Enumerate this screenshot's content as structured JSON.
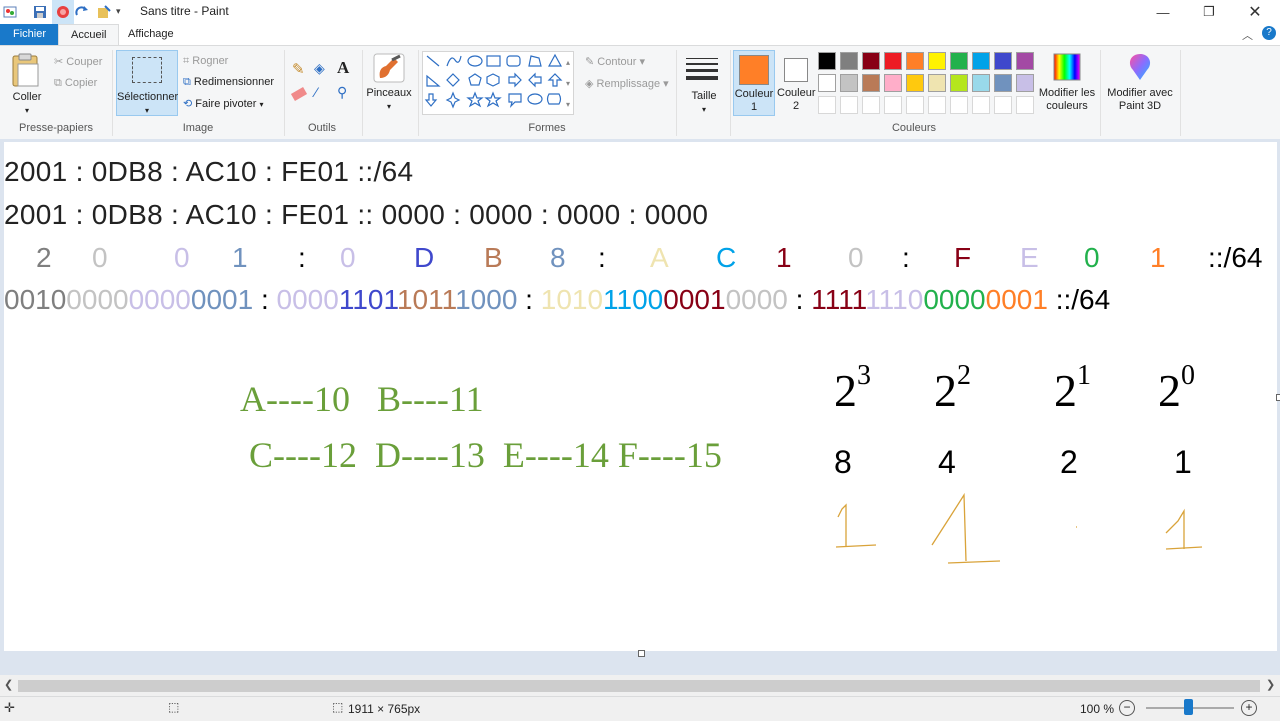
{
  "window": {
    "title": "Sans titre - Paint"
  },
  "tabs": {
    "file": "Fichier",
    "home": "Accueil",
    "view": "Affichage"
  },
  "clipboard": {
    "paste": "Coller",
    "cut": "Couper",
    "copy": "Copier",
    "group": "Presse-papiers"
  },
  "image": {
    "select": "Sélectionner",
    "crop": "Rogner",
    "resize": "Redimensionner",
    "rotate": "Faire pivoter",
    "group": "Image"
  },
  "tools": {
    "group": "Outils"
  },
  "brushes": {
    "label": "Pinceaux"
  },
  "shapes": {
    "outline": "Contour",
    "fill": "Remplissage",
    "group": "Formes"
  },
  "size": {
    "label": "Taille"
  },
  "colors": {
    "color1": "Couleur 1",
    "color1_a": "Couleur",
    "color1_b": "1",
    "color2_a": "Couleur",
    "color2_b": "2",
    "edit_a": "Modifier les",
    "edit_b": "couleurs",
    "paint3d_a": "Modifier avec",
    "paint3d_b": "Paint 3D",
    "group": "Couleurs",
    "color1_value": "#ff7f27",
    "color2_value": "#ffffff",
    "palette_row1": [
      "#000000",
      "#7f7f7f",
      "#880015",
      "#ed1c24",
      "#ff7f27",
      "#fff200",
      "#22b14c",
      "#00a2e8",
      "#3f48cc",
      "#a349a4"
    ],
    "palette_row2": [
      "#ffffff",
      "#c3c3c3",
      "#b97a57",
      "#ffaec9",
      "#ffc90e",
      "#efe4b0",
      "#b5e61d",
      "#99d9ea",
      "#7092be",
      "#c8bfe7"
    ]
  },
  "canvas": {
    "line1": "2001 : 0DB8 : AC10 : FE01 ::/64",
    "line2": "2001 : 0DB8 : AC10 : FE01 :: 0000 : 0000 : 0000 : 0000",
    "line3": [
      {
        "t": "2",
        "c": "#7f7f7f"
      },
      {
        "t": "0",
        "c": "#c3c3c3"
      },
      {
        "t": "0",
        "c": "#c8bfe7"
      },
      {
        "t": "1",
        "c": "#7092be"
      },
      {
        "t": ":",
        "c": "#000000"
      },
      {
        "t": "0",
        "c": "#c8bfe7"
      },
      {
        "t": "D",
        "c": "#3f48cc"
      },
      {
        "t": "B",
        "c": "#b97a57"
      },
      {
        "t": "8",
        "c": "#7092be"
      },
      {
        "t": ":",
        "c": "#000000"
      },
      {
        "t": "A",
        "c": "#efe4b0"
      },
      {
        "t": "C",
        "c": "#00a2e8"
      },
      {
        "t": "1",
        "c": "#880015"
      },
      {
        "t": "0",
        "c": "#c3c3c3"
      },
      {
        "t": ":",
        "c": "#000000"
      },
      {
        "t": "F",
        "c": "#880015"
      },
      {
        "t": "E",
        "c": "#c8bfe7"
      },
      {
        "t": "0",
        "c": "#22b14c"
      },
      {
        "t": "1",
        "c": "#ff7f27"
      },
      {
        "t": "::/64",
        "c": "#000000"
      }
    ],
    "line4": [
      {
        "t": "0010",
        "c": "#7f7f7f"
      },
      {
        "t": "0000",
        "c": "#c3c3c3"
      },
      {
        "t": "0000",
        "c": "#c8bfe7"
      },
      {
        "t": "0001",
        "c": "#7092be"
      },
      {
        "t": " : ",
        "c": "#000000"
      },
      {
        "t": "0000",
        "c": "#c8bfe7"
      },
      {
        "t": "1101",
        "c": "#3f48cc"
      },
      {
        "t": "1011",
        "c": "#b97a57"
      },
      {
        "t": "1000",
        "c": "#7092be"
      },
      {
        "t": " : ",
        "c": "#000000"
      },
      {
        "t": "1010",
        "c": "#efe4b0"
      },
      {
        "t": "1100",
        "c": "#00a2e8"
      },
      {
        "t": "0001",
        "c": "#880015"
      },
      {
        "t": "0000",
        "c": "#c3c3c3"
      },
      {
        "t": " : ",
        "c": "#000000"
      },
      {
        "t": "1111",
        "c": "#880015"
      },
      {
        "t": "1110",
        "c": "#c8bfe7"
      },
      {
        "t": "0000",
        "c": "#22b14c"
      },
      {
        "t": "0001",
        "c": "#ff7f27"
      },
      {
        "t": " ::/64",
        "c": "#000000"
      }
    ],
    "hex_row1": "A----10   B----11",
    "hex_row2": "C----12  D----13  E----14 F----15",
    "pow_base": "2",
    "pow_exps": [
      "3",
      "2",
      "1",
      "0"
    ],
    "weights": [
      "8",
      "4",
      "2",
      "1"
    ]
  },
  "status": {
    "dimensions": "1911 × 765px",
    "zoom": "100 %"
  }
}
